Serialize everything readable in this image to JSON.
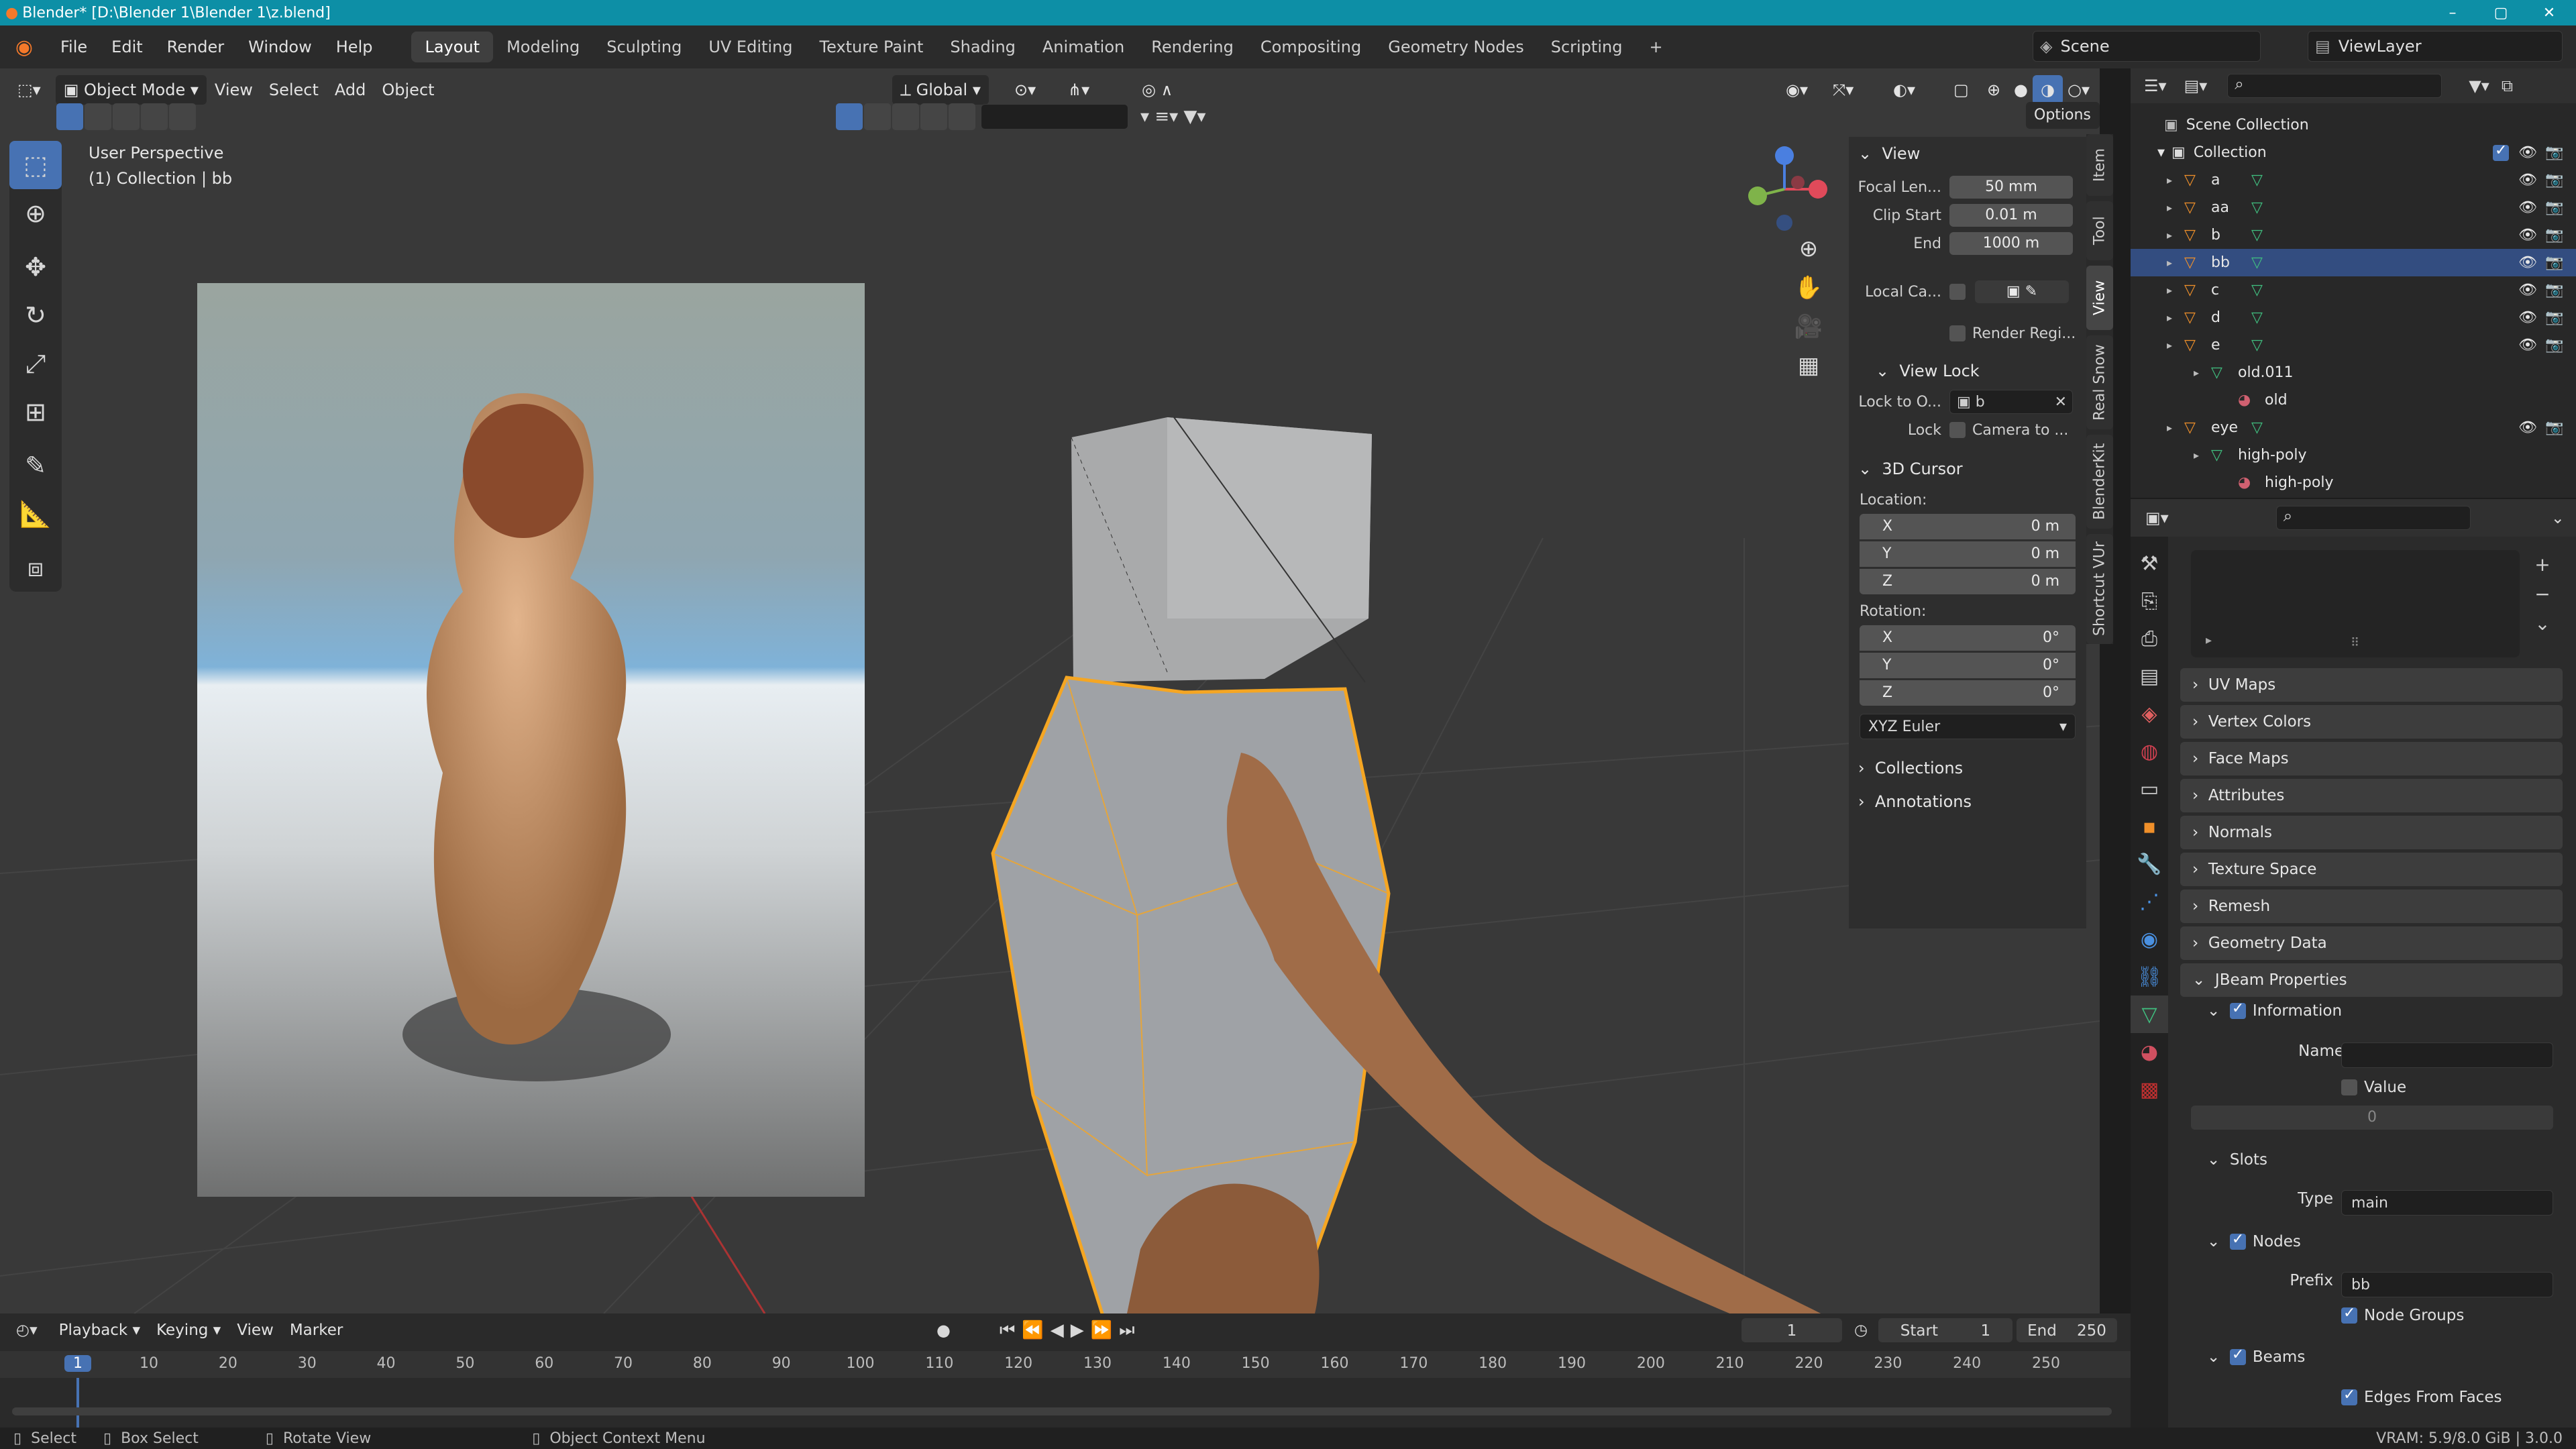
{
  "window": {
    "title": "Blender* [D:\\Blender 1\\Blender 1\\z.blend]",
    "minimize": "–",
    "maximize": "▢",
    "close": "✕"
  },
  "menu": [
    "File",
    "Edit",
    "Render",
    "Window",
    "Help"
  ],
  "workspaces": [
    "Layout",
    "Modeling",
    "Sculpting",
    "UV Editing",
    "Texture Paint",
    "Shading",
    "Animation",
    "Rendering",
    "Compositing",
    "Geometry Nodes",
    "Scripting"
  ],
  "workspace_add": "+",
  "scene": {
    "label": "Scene",
    "view_layer": "ViewLayer"
  },
  "viewport_header": {
    "mode": "Object Mode",
    "menus": [
      "View",
      "Select",
      "Add",
      "Object"
    ],
    "orientation": "Global",
    "options": "Options"
  },
  "viewport": {
    "perspective": "User Perspective",
    "collection_info": "(1) Collection | bb"
  },
  "npanel": {
    "view_title": "View",
    "focal_label": "Focal Len...",
    "focal_value": "50 mm",
    "clip_start_label": "Clip Start",
    "clip_start_value": "0.01 m",
    "end_label": "End",
    "end_value": "1000 m",
    "local_camera_label": "Local Ca...",
    "render_region_label": "Render Regi...",
    "view_lock_title": "View Lock",
    "lock_object_label": "Lock to O...",
    "lock_object_value": "b",
    "lock_label": "Lock",
    "camera_to_label": "Camera to ...",
    "cursor_title": "3D Cursor",
    "location_label": "Location:",
    "loc": [
      {
        "axis": "X",
        "value": "0 m"
      },
      {
        "axis": "Y",
        "value": "0 m"
      },
      {
        "axis": "Z",
        "value": "0 m"
      }
    ],
    "rotation_label": "Rotation:",
    "rot": [
      {
        "axis": "X",
        "value": "0°"
      },
      {
        "axis": "Y",
        "value": "0°"
      },
      {
        "axis": "Z",
        "value": "0°"
      }
    ],
    "rotation_mode": "XYZ Euler",
    "collections_title": "Collections",
    "annotations_title": "Annotations"
  },
  "side_tabs": [
    "Item",
    "Tool",
    "View",
    "Real Snow",
    "BlenderKit",
    "Shortcut VUr"
  ],
  "outliner": {
    "scene_collection": "Scene Collection",
    "collection": "Collection",
    "items": [
      {
        "name": "a",
        "depth": 1,
        "type": "object",
        "visible": true
      },
      {
        "name": "aa",
        "depth": 1,
        "type": "object",
        "visible": true
      },
      {
        "name": "b",
        "depth": 1,
        "type": "object",
        "visible": true
      },
      {
        "name": "bb",
        "depth": 1,
        "type": "object",
        "visible": true,
        "selected": true
      },
      {
        "name": "c",
        "depth": 1,
        "type": "object",
        "visible": true
      },
      {
        "name": "d",
        "depth": 1,
        "type": "object",
        "visible": true
      },
      {
        "name": "e",
        "depth": 1,
        "type": "object",
        "visible": true
      },
      {
        "name": "old.011",
        "depth": 2,
        "type": "mesh",
        "visible": false
      },
      {
        "name": "old",
        "depth": 3,
        "type": "material",
        "visible": false
      },
      {
        "name": "eye",
        "depth": 1,
        "type": "object",
        "visible": true
      },
      {
        "name": "high-poly",
        "depth": 2,
        "type": "mesh",
        "visible": false
      },
      {
        "name": "high-poly",
        "depth": 3,
        "type": "material",
        "visible": false
      }
    ]
  },
  "properties": {
    "panels": [
      "UV Maps",
      "Vertex Colors",
      "Face Maps",
      "Attributes",
      "Normals",
      "Texture Space",
      "Remesh",
      "Geometry Data"
    ],
    "jbeam_title": "JBeam Properties",
    "information_label": "Information",
    "name_label": "Name",
    "value_label": "Value",
    "value_number": "0",
    "slots_label": "Slots",
    "type_label": "Type",
    "type_value": "main",
    "nodes_label": "Nodes",
    "prefix_label": "Prefix",
    "prefix_value": "bb",
    "node_groups_label": "Node Groups",
    "beams_label": "Beams",
    "edges_from_faces_label": "Edges From Faces"
  },
  "timeline": {
    "menus": [
      "Playback",
      "Keying",
      "View",
      "Marker"
    ],
    "current_frame": "1",
    "start_label": "Start",
    "start_value": "1",
    "end_label": "End",
    "end_value": "250",
    "ticks": [
      "1",
      "10",
      "20",
      "30",
      "40",
      "50",
      "60",
      "70",
      "80",
      "90",
      "100",
      "110",
      "120",
      "130",
      "140",
      "150",
      "160",
      "170",
      "180",
      "190",
      "200",
      "210",
      "220",
      "230",
      "240",
      "250"
    ]
  },
  "statusbar": {
    "select": "Select",
    "box_select": "Box Select",
    "rotate_view": "Rotate View",
    "context_menu": "Object Context Menu",
    "vram": "VRAM: 5.9/8.0 GiB | 3.0.0"
  },
  "colors": {
    "accent": "#4772b3",
    "selection_orange": "#f5a623",
    "titlebar": "#0d8fa6"
  }
}
